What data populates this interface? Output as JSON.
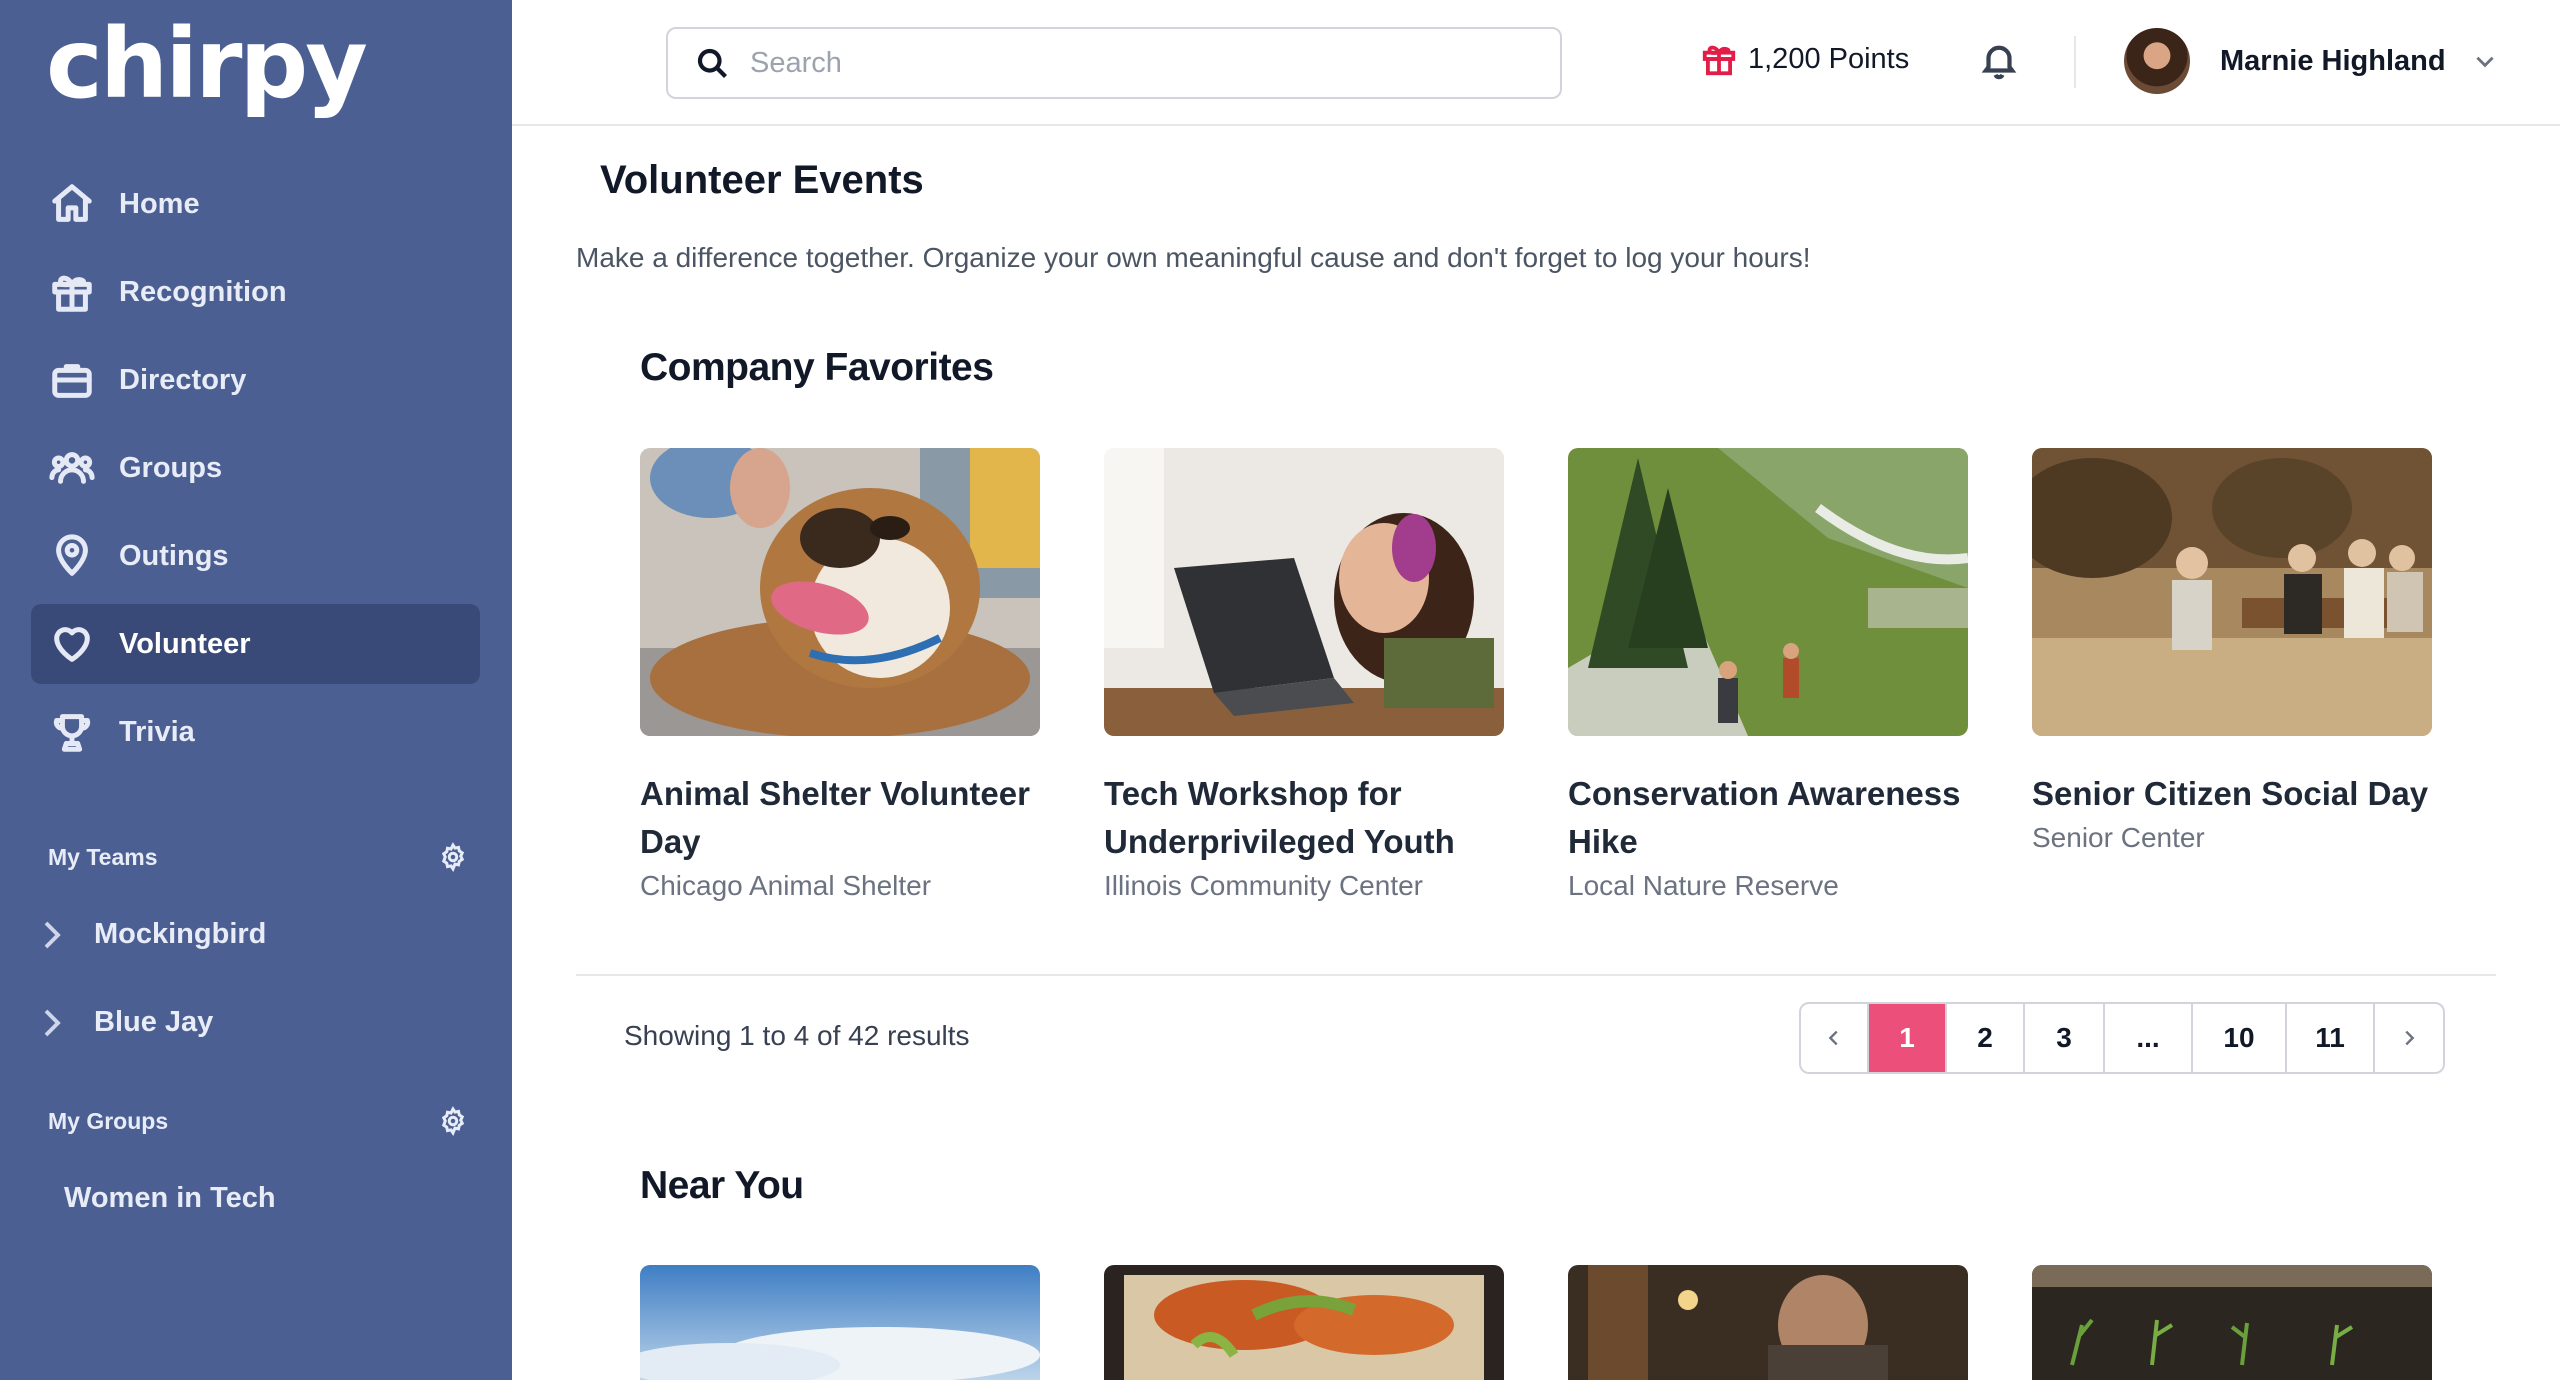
{
  "app": {
    "logo": "chirpy"
  },
  "sidebar": {
    "nav": [
      {
        "label": "Home",
        "icon": "home-icon"
      },
      {
        "label": "Recognition",
        "icon": "gift-icon"
      },
      {
        "label": "Directory",
        "icon": "briefcase-icon"
      },
      {
        "label": "Groups",
        "icon": "users-icon"
      },
      {
        "label": "Outings",
        "icon": "map-pin-icon"
      },
      {
        "label": "Volunteer",
        "icon": "heart-icon",
        "active": true
      },
      {
        "label": "Trivia",
        "icon": "trophy-icon"
      }
    ],
    "my_teams": {
      "title": "My Teams",
      "items": [
        "Mockingbird",
        "Blue Jay"
      ]
    },
    "my_groups": {
      "title": "My Groups",
      "items": [
        "Women in Tech"
      ]
    }
  },
  "header": {
    "search_placeholder": "Search",
    "points": "1,200 Points",
    "user_name": "Marnie Highland"
  },
  "main": {
    "title": "Volunteer Events",
    "description": "Make a difference together. Organize your own meaningful cause and don't forget to log your hours!",
    "company_favorites": {
      "title": "Company Favorites",
      "cards": [
        {
          "title": "Animal Shelter Volunteer Day",
          "location": "Chicago Animal Shelter"
        },
        {
          "title": "Tech Workshop for Underprivileged Youth",
          "location": "Illinois Community Center"
        },
        {
          "title": "Conservation Awareness Hike",
          "location": "Local Nature Reserve"
        },
        {
          "title": "Senior Citizen Social Day",
          "location": "Senior Center"
        }
      ]
    },
    "pagination": {
      "showing": "Showing 1 to 4 of 42 results",
      "pages": [
        "1",
        "2",
        "3",
        "...",
        "10",
        "11"
      ],
      "current": "1"
    },
    "near_you": {
      "title": "Near You"
    }
  },
  "colors": {
    "sidebar": "#4c5f93",
    "sidebar_active": "#3a4a78",
    "accent": "#ec4f79",
    "points_icon": "#e11d48"
  }
}
